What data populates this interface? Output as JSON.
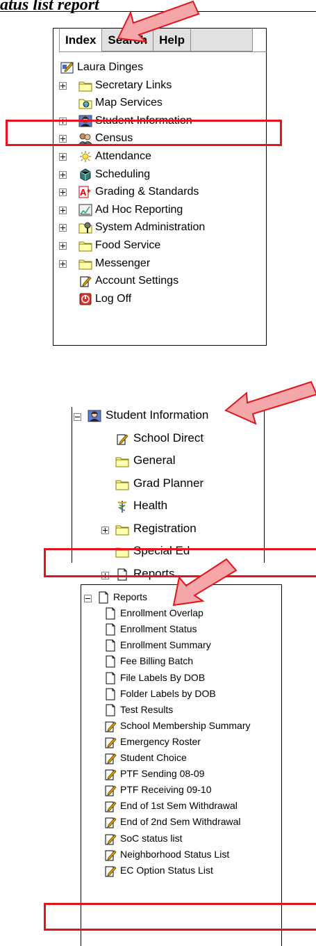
{
  "page": {
    "heading": "atus list report"
  },
  "colors": {
    "highlight": "#e3141b",
    "arrow_fill": "#f4a6a8",
    "arrow_stroke": "#e3141b",
    "folder": "#ffffb0",
    "folder_stroke": "#8a7d00"
  },
  "tabs": [
    {
      "label": "Index",
      "active": true
    },
    {
      "label": "Search",
      "active": false
    },
    {
      "label": "Help",
      "active": false
    }
  ],
  "index_tree": {
    "root": {
      "label": "Laura Dinges",
      "icon": "user-card-icon"
    },
    "items": [
      {
        "label": "Secretary Links",
        "icon": "folder-icon",
        "expandable": true
      },
      {
        "label": "Map Services",
        "icon": "map-icon",
        "expandable": false
      },
      {
        "label": "Student Information",
        "icon": "student-icon",
        "expandable": true
      },
      {
        "label": "Census",
        "icon": "census-icon",
        "expandable": true
      },
      {
        "label": "Attendance",
        "icon": "attendance-icon",
        "expandable": true
      },
      {
        "label": "Scheduling",
        "icon": "scheduling-icon",
        "expandable": true
      },
      {
        "label": "Grading & Standards",
        "icon": "grading-icon",
        "expandable": true
      },
      {
        "label": "Ad Hoc Reporting",
        "icon": "chart-icon",
        "expandable": true
      },
      {
        "label": "System Administration",
        "icon": "admin-icon",
        "expandable": true
      },
      {
        "label": "Food Service",
        "icon": "folder-icon",
        "expandable": true
      },
      {
        "label": "Messenger",
        "icon": "folder-icon",
        "expandable": true
      },
      {
        "label": "Account Settings",
        "icon": "tool-icon",
        "expandable": false
      },
      {
        "label": "Log Off",
        "icon": "power-icon",
        "expandable": false
      }
    ]
  },
  "student_info_tree": {
    "root": {
      "label": "Student Information",
      "icon": "student-icon"
    },
    "items": [
      {
        "label": "School Direct",
        "icon": "tool-icon",
        "expandable": false
      },
      {
        "label": "General",
        "icon": "folder-icon",
        "expandable": false
      },
      {
        "label": "Grad Planner",
        "icon": "folder-icon",
        "expandable": false
      },
      {
        "label": "Health",
        "icon": "health-icon",
        "expandable": false
      },
      {
        "label": "Registration",
        "icon": "folder-icon",
        "expandable": true
      },
      {
        "label": "Special Ed",
        "icon": "folder-icon",
        "expandable": false
      },
      {
        "label": "Reports",
        "icon": "page-icon",
        "expandable": true
      }
    ]
  },
  "reports_tree": {
    "root": {
      "label": "Reports",
      "icon": "page-icon"
    },
    "items": [
      {
        "label": "Enrollment Overlap",
        "icon": "page-icon"
      },
      {
        "label": "Enrollment Status",
        "icon": "page-icon"
      },
      {
        "label": "Enrollment Summary",
        "icon": "page-icon"
      },
      {
        "label": "Fee Billing Batch",
        "icon": "page-icon"
      },
      {
        "label": "File Labels By DOB",
        "icon": "page-icon"
      },
      {
        "label": "Folder Labels by DOB",
        "icon": "page-icon"
      },
      {
        "label": "Test Results",
        "icon": "page-icon"
      },
      {
        "label": "School Membership Summary",
        "icon": "tool-icon"
      },
      {
        "label": "Emergency Roster",
        "icon": "tool-icon"
      },
      {
        "label": "Student Choice",
        "icon": "tool-icon"
      },
      {
        "label": "PTF Sending 08-09",
        "icon": "tool-icon"
      },
      {
        "label": "PTF Receiving 09-10",
        "icon": "tool-icon"
      },
      {
        "label": "End of 1st Sem Withdrawal",
        "icon": "tool-icon"
      },
      {
        "label": "End of 2nd Sem Withdrawal",
        "icon": "tool-icon"
      },
      {
        "label": "SoC status list",
        "icon": "tool-icon"
      },
      {
        "label": "Neighborhood Status List",
        "icon": "tool-icon"
      },
      {
        "label": "EC Option Status List",
        "icon": "tool-icon"
      }
    ]
  }
}
